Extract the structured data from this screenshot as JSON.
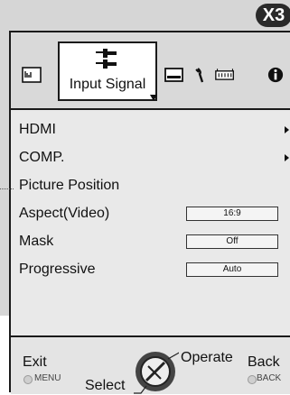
{
  "badge": "X3",
  "tabs": {
    "active_label": "Input Signal",
    "icons": [
      "picture-adjust-icon",
      "input-signal-icon",
      "installation-icon",
      "display-setup-icon",
      "function-icon",
      "information-icon"
    ]
  },
  "menu": {
    "items": [
      {
        "label": "HDMI",
        "has_submenu": true
      },
      {
        "label": "COMP.",
        "has_submenu": true
      },
      {
        "label": "Picture Position",
        "has_submenu": false
      },
      {
        "label": "Aspect(Video)",
        "value": "16:9"
      },
      {
        "label": "Mask",
        "value": "Off"
      },
      {
        "label": "Progressive",
        "value": "Auto"
      }
    ]
  },
  "footer": {
    "exit": "Exit",
    "exit_key": "MENU",
    "select": "Select",
    "operate": "Operate",
    "back": "Back",
    "back_key": "BACK"
  }
}
